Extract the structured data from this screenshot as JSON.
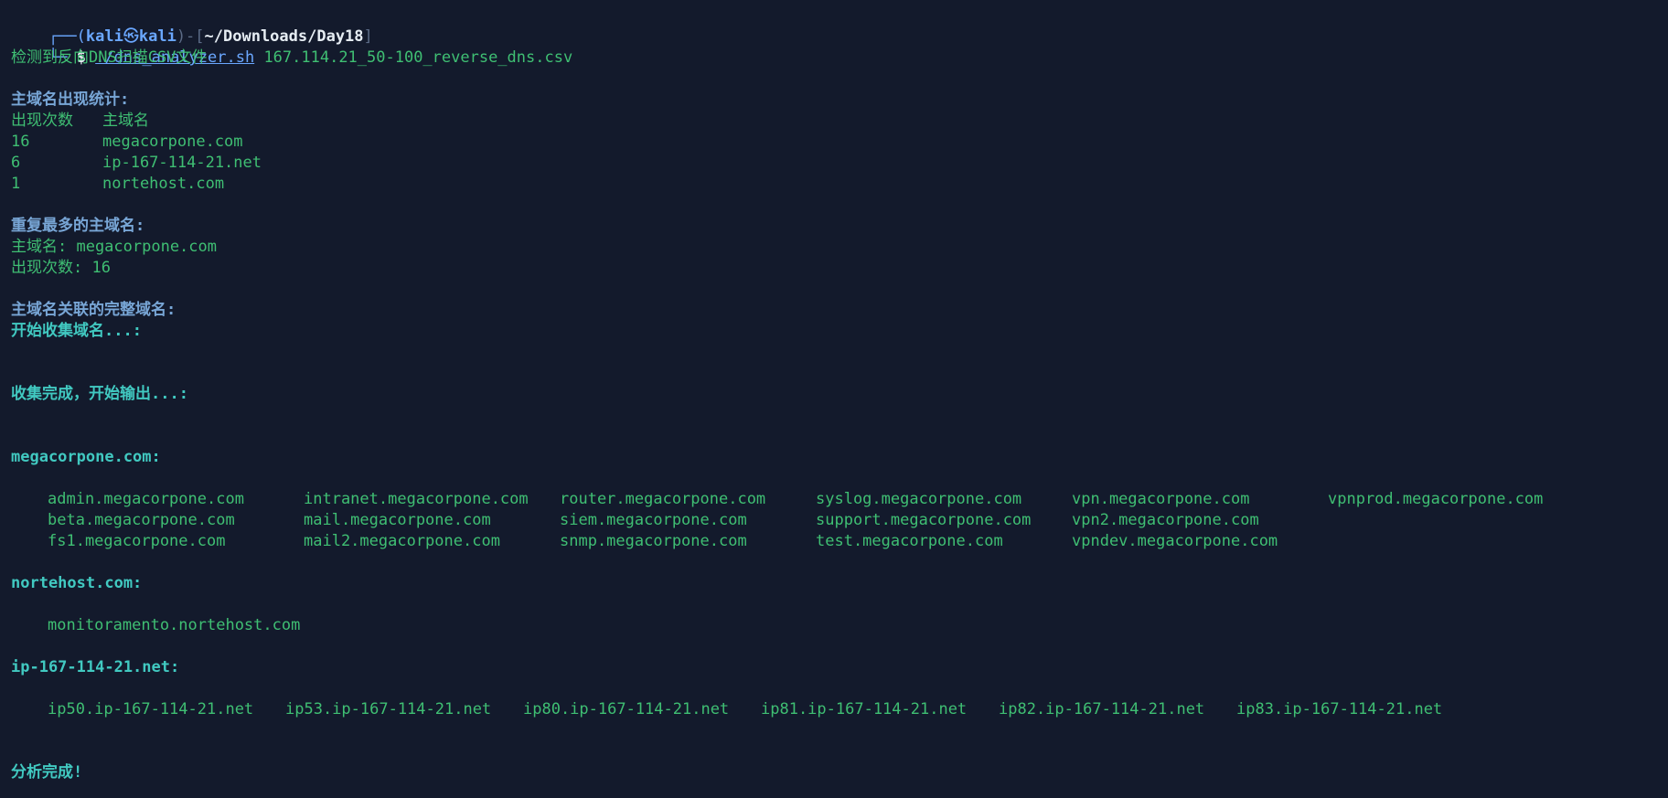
{
  "prompt": {
    "corner_top": "┌──(",
    "user": "kali",
    "at": "㉿",
    "host": "kali",
    "mid": ")-[",
    "path": "~/Downloads/Day18",
    "end": "]",
    "corner_bottom": "└─",
    "dollar": "$",
    "command": "./dns_analyzer.sh",
    "argument": "167.114.21_50-100_reverse_dns.csv"
  },
  "detect_message": "检测到反向DNS扫描CSV文件",
  "stats": {
    "title": "主域名出现统计:",
    "header_count": "出现次数",
    "header_domain": "主域名",
    "rows": [
      {
        "count": "16",
        "domain": "megacorpone.com"
      },
      {
        "count": "6",
        "domain": "ip-167-114-21.net"
      },
      {
        "count": "1",
        "domain": "nortehost.com"
      }
    ]
  },
  "top": {
    "title": "重复最多的主域名:",
    "domain_line": "主域名: megacorpone.com",
    "count_line": "出现次数: 16"
  },
  "assoc_title": "主域名关联的完整域名:",
  "collect_start": "开始收集域名...:",
  "collect_done": "收集完成，开始输出...:",
  "groups": {
    "mega": {
      "title": "megacorpone.com:",
      "rows": [
        [
          "admin.megacorpone.com",
          "intranet.megacorpone.com",
          "router.megacorpone.com",
          "syslog.megacorpone.com",
          "vpn.megacorpone.com",
          "vpnprod.megacorpone.com"
        ],
        [
          "beta.megacorpone.com",
          "mail.megacorpone.com",
          "siem.megacorpone.com",
          "support.megacorpone.com",
          "vpn2.megacorpone.com"
        ],
        [
          "fs1.megacorpone.com",
          "mail2.megacorpone.com",
          "snmp.megacorpone.com",
          "test.megacorpone.com",
          "vpndev.megacorpone.com"
        ]
      ]
    },
    "norte": {
      "title": "nortehost.com:",
      "items": [
        "monitoramento.nortehost.com"
      ]
    },
    "ip": {
      "title": "ip-167-114-21.net:",
      "items": [
        "ip50.ip-167-114-21.net",
        "ip53.ip-167-114-21.net",
        "ip80.ip-167-114-21.net",
        "ip81.ip-167-114-21.net",
        "ip82.ip-167-114-21.net",
        "ip83.ip-167-114-21.net"
      ]
    }
  },
  "done": "分析完成!"
}
